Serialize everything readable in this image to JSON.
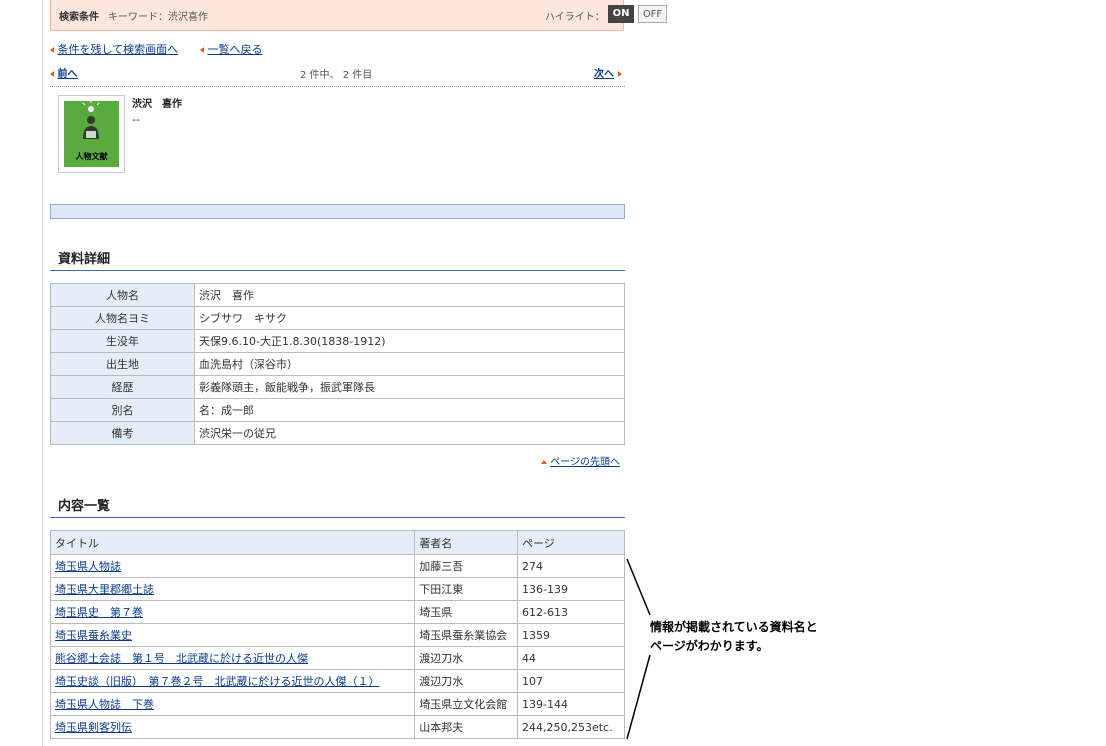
{
  "search_conditions": {
    "label": "検索条件",
    "keyword": "キーワード：渋沢喜作",
    "highlight_label": "ハイライト：",
    "on_label": "ON",
    "off_label": "OFF"
  },
  "nav": {
    "back_to_search": "条件を残して検索画面へ",
    "back_to_list": "一覧へ戻る",
    "prev": "前へ",
    "next": "次へ",
    "count": "2 件中、 2 件目"
  },
  "record": {
    "thumbnail_label": "人物文献",
    "name": "渋沢　喜作",
    "subtitle": "--"
  },
  "detail_section": {
    "title": "資料詳細",
    "rows": [
      {
        "key": "人物名",
        "value": "渋沢　喜作"
      },
      {
        "key": "人物名ヨミ",
        "value": "シブサワ　キサク"
      },
      {
        "key": "生没年",
        "value": "天保9.6.10-大正1.8.30(1838-1912)"
      },
      {
        "key": "出生地",
        "value": "血洗島村（深谷市）"
      },
      {
        "key": "経歴",
        "value": "彰義隊頭主，飯能戦争，振武軍隊長"
      },
      {
        "key": "別名",
        "value": "名：成一郎"
      },
      {
        "key": "備考",
        "value": "渋沢栄一の従兄"
      }
    ],
    "to_top": "ページの先頭へ"
  },
  "contents_section": {
    "title": "内容一覧",
    "headers": [
      "タイトル",
      "著者名",
      "ページ"
    ],
    "rows": [
      {
        "title": "埼玉県人物誌",
        "author": "加藤三吾",
        "page": "274"
      },
      {
        "title": "埼玉県大里郡郷土誌",
        "author": "下田江東",
        "page": "136-139"
      },
      {
        "title": "埼玉県史　第７巻",
        "author": "埼玉県",
        "page": "612-613"
      },
      {
        "title": "埼玉県蚕糸業史",
        "author": "埼玉県蚕糸業協会",
        "page": "1359"
      },
      {
        "title": "熊谷郷土会誌　第１号　北武蔵に於ける近世の人傑",
        "author": "渡辺刀水",
        "page": "44"
      },
      {
        "title": "埼玉史談（旧版）　第７巻２号　北武蔵に於ける近世の人傑（１）",
        "author": "渡辺刀水",
        "page": "107"
      },
      {
        "title": "埼玉県人物誌　下巻",
        "author": "埼玉県立文化会館",
        "page": "139-144"
      },
      {
        "title": "埼玉県剣客列伝",
        "author": "山本邦夫",
        "page": "244,250,253etc."
      }
    ]
  },
  "annotation": {
    "line1": "情報が掲載されている資料名と",
    "line2": "ページがわかります。"
  },
  "colors": {
    "accent": "#e05a1c",
    "link": "#0b3b8c",
    "thumbnail_bg": "#5aab3e",
    "table_header_bg": "#e3eef9"
  }
}
